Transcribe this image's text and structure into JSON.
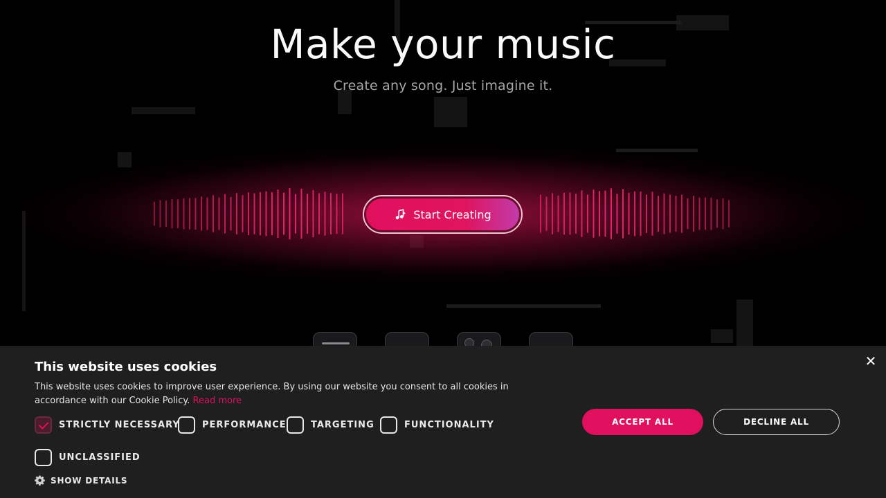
{
  "hero": {
    "title": "Make your music",
    "subtitle": "Create any song. Just imagine it.",
    "cta_label": "Start Creating",
    "cta_icon": "music-note-sparkle-icon"
  },
  "cookie_banner": {
    "title": "This website uses cookies",
    "text": "This website uses cookies to improve user experience. By using our website you consent to all cookies in accordance with our Cookie Policy.",
    "read_more": "Read more",
    "categories": [
      {
        "label": "STRICTLY NECESSARY",
        "checked": true
      },
      {
        "label": "PERFORMANCE",
        "checked": false
      },
      {
        "label": "TARGETING",
        "checked": false
      },
      {
        "label": "FUNCTIONALITY",
        "checked": false
      },
      {
        "label": "UNCLASSIFIED",
        "checked": false
      }
    ],
    "show_details": "SHOW DETAILS",
    "accept_all": "ACCEPT ALL",
    "decline_all": "DECLINE ALL",
    "close_icon": "close-icon"
  },
  "colors": {
    "accent": "#e0105e",
    "background": "#000000",
    "banner": "#1f1f1f"
  }
}
